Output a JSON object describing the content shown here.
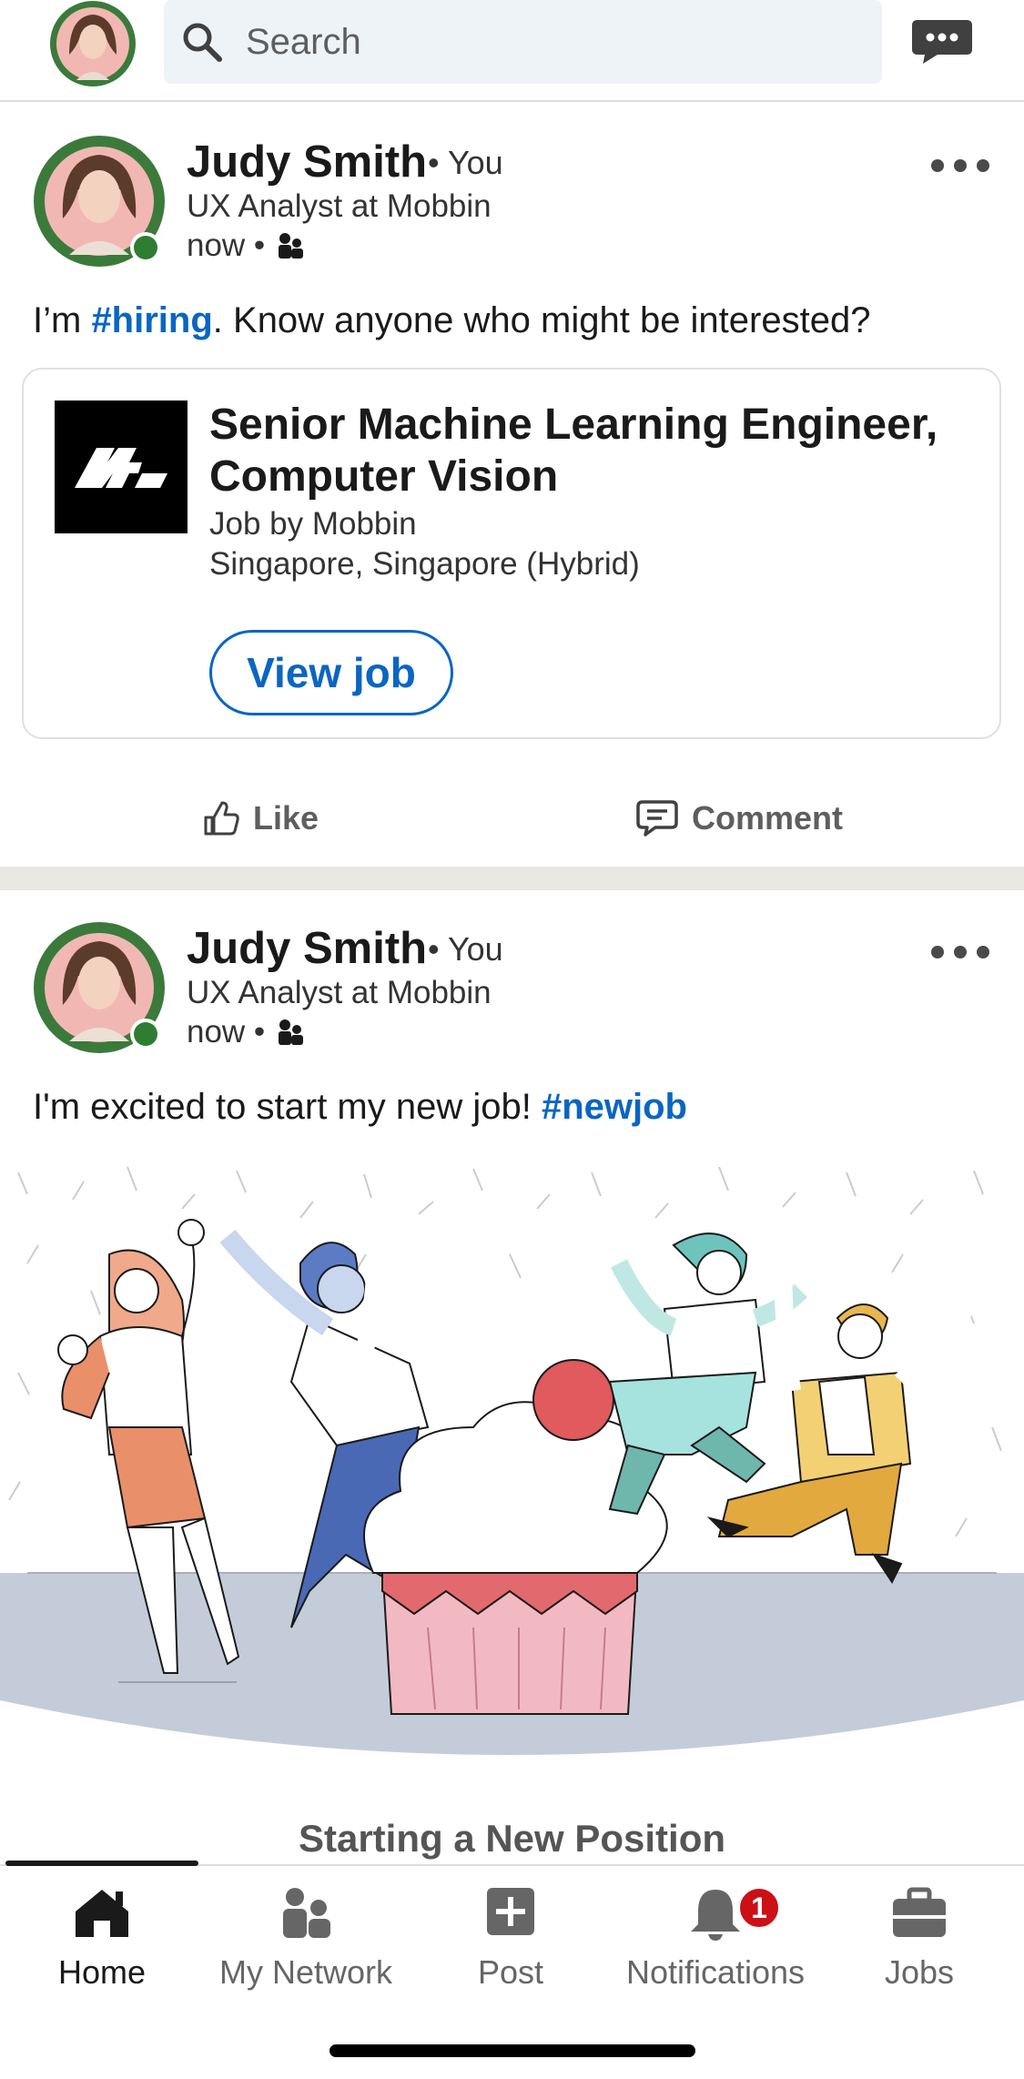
{
  "topbar": {
    "search_placeholder": "Search",
    "avatar_badge": "#OPENTOWORK"
  },
  "posts": [
    {
      "author": "Judy Smith",
      "you_label": "• You",
      "headline": "UX Analyst at Mobbin",
      "time": "now •",
      "avatar_badge": "#OPENTOWORK",
      "text_before": "I’m ",
      "hashtag": "#hiring",
      "text_after": ". Know anyone who might be interested?",
      "job": {
        "title": "Senior Machine Learning Engineer, Computer Vision",
        "company": "Job by Mobbin",
        "location": "Singapore, Singapore (Hybrid)",
        "button": "View job"
      },
      "actions": {
        "like": "Like",
        "comment": "Comment"
      }
    },
    {
      "author": "Judy Smith",
      "you_label": "• You",
      "headline": "UX Analyst at Mobbin",
      "time": "now •",
      "avatar_badge": "#OPENTOWORK",
      "text_before": "I'm excited to start my new job! ",
      "hashtag": "#newjob",
      "illustration_caption": "Starting a New Position"
    }
  ],
  "bottom_nav": {
    "items": [
      {
        "label": "Home",
        "icon": "home-icon",
        "active": true
      },
      {
        "label": "My Network",
        "icon": "network-icon"
      },
      {
        "label": "Post",
        "icon": "post-icon"
      },
      {
        "label": "Notifications",
        "icon": "bell-icon",
        "badge": "1"
      },
      {
        "label": "Jobs",
        "icon": "briefcase-icon"
      }
    ]
  },
  "colors": {
    "accent_blue": "#0a66c2",
    "online_green": "#2e7d32",
    "badge_red": "#cc1016",
    "open_to_work_green": "#3b7a3b"
  }
}
